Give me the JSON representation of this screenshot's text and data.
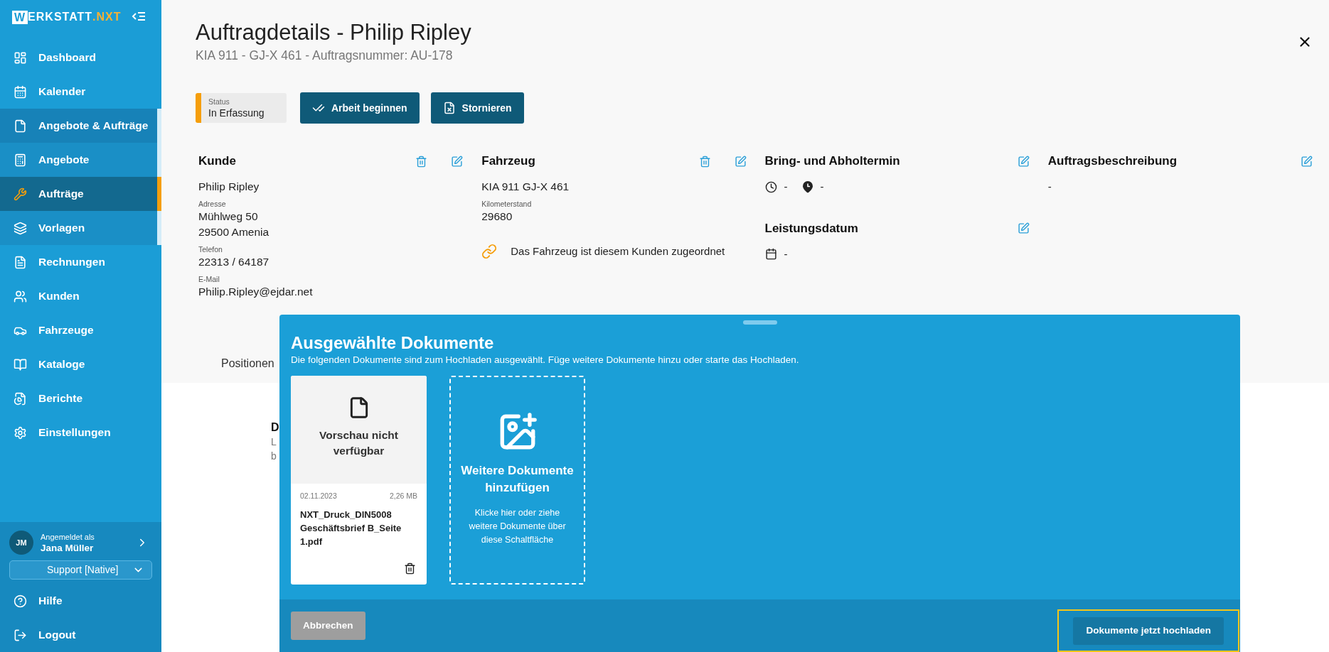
{
  "brand": {
    "initial": "W",
    "name": "ERKSTATT",
    "accent": ".NXT"
  },
  "sidebar": {
    "items": [
      {
        "label": "Dashboard",
        "selected": false
      },
      {
        "label": "Kalender",
        "selected": false
      },
      {
        "label": "Angebote & Aufträge",
        "selected": false,
        "expanded": true,
        "children": [
          {
            "label": "Angebote",
            "selected": false
          },
          {
            "label": "Aufträge",
            "selected": true
          },
          {
            "label": "Vorlagen",
            "selected": false
          }
        ]
      },
      {
        "label": "Rechnungen",
        "selected": false
      },
      {
        "label": "Kunden",
        "selected": false
      },
      {
        "label": "Fahrzeuge",
        "selected": false
      },
      {
        "label": "Kataloge",
        "selected": false
      },
      {
        "label": "Berichte",
        "selected": false
      },
      {
        "label": "Einstellungen",
        "selected": false
      }
    ],
    "user": {
      "initials": "JM",
      "caption": "Angemeldet als",
      "name": "Jana Müller"
    },
    "role_select": {
      "value": "Support [Native]"
    },
    "footer_items": [
      {
        "label": "Hilfe"
      },
      {
        "label": "Logout"
      }
    ]
  },
  "header": {
    "title": "Auftragdetails - Philip Ripley",
    "subtitle": "KIA 911 - GJ-X 461 - Auftragsnummer: AU-178"
  },
  "status": {
    "label": "Status",
    "value": "In Erfassung"
  },
  "actions": [
    {
      "label": "Arbeit beginnen"
    },
    {
      "label": "Stornieren"
    }
  ],
  "columns": [
    {
      "sections": [
        {
          "title": "Kunde",
          "deletable": true,
          "lines": [
            {
              "kind": "value",
              "text": "Philip Ripley"
            },
            {
              "kind": "label",
              "text": "Adresse"
            },
            {
              "kind": "value",
              "text": "Mühlweg 50"
            },
            {
              "kind": "value",
              "text": "29500 Amenia"
            },
            {
              "kind": "label",
              "text": "Telefon"
            },
            {
              "kind": "value",
              "text": "22313 / 64187"
            },
            {
              "kind": "label",
              "text": "E-Mail"
            },
            {
              "kind": "value",
              "text": "Philip.Ripley@ejdar.net"
            }
          ]
        }
      ]
    },
    {
      "sections": [
        {
          "title": "Fahrzeug",
          "deletable": true,
          "lines": [
            {
              "kind": "value",
              "text": "KIA 911 GJ-X 461"
            },
            {
              "kind": "label",
              "text": "Kilometerstand"
            },
            {
              "kind": "value",
              "text": "29680"
            },
            {
              "kind": "link_note",
              "text": "Das Fahrzeug ist diesem Kunden zugeordnet"
            }
          ]
        }
      ]
    },
    {
      "sections": [
        {
          "title": "Bring- und Abholtermin",
          "deletable": false,
          "lines": [
            {
              "kind": "times",
              "bring": "-",
              "pickup": "-"
            }
          ]
        },
        {
          "title": "Leistungsdatum",
          "deletable": false,
          "lines": [
            {
              "kind": "date",
              "text": "-"
            }
          ]
        }
      ]
    },
    {
      "sections": [
        {
          "title": "Auftragsbeschreibung",
          "deletable": false,
          "lines": [
            {
              "kind": "plain",
              "text": "-"
            }
          ]
        }
      ]
    }
  ],
  "background": {
    "tab": "Positionen",
    "fragments": [
      "D",
      "L",
      "b"
    ]
  },
  "dialog": {
    "title": "Ausgewählte Dokumente",
    "description": "Die folgenden Dokumente sind zum Hochladen ausgewählt. Füge weitere Dokumente hinzu oder starte das Hochladen.",
    "documents": [
      {
        "preview": "Vorschau nicht verfügbar",
        "date": "02.11.2023",
        "size": "2,26 MB",
        "filename": "NXT_Druck_DIN5008 Geschäftsbrief B_Seite 1.pdf"
      }
    ],
    "dropzone": {
      "title": "Weitere Dokumente hinzufügen",
      "hint": "Klicke hier oder ziehe weitere Dokumente über diese Schaltfläche"
    },
    "cancel": "Abbrechen",
    "submit": "Dokumente jetzt hochladen",
    "submit_focused": true
  }
}
